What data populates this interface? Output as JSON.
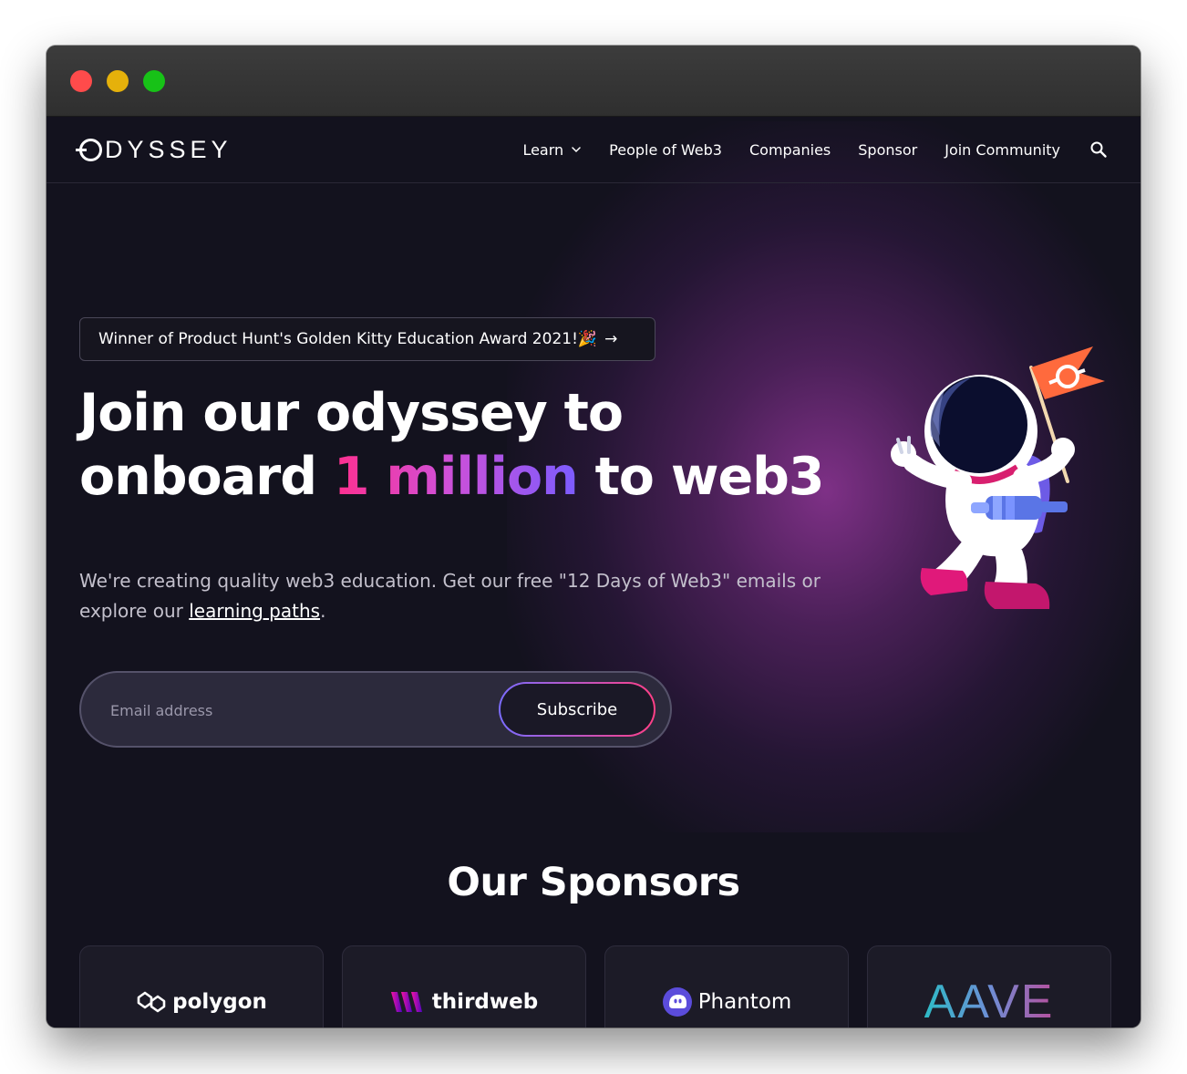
{
  "window": {
    "buttons": [
      "close",
      "minimize",
      "maximize"
    ]
  },
  "brand": {
    "logo_text": "DYSSEY",
    "logo_full": "ODYSSEY"
  },
  "nav": {
    "items": [
      {
        "label": "Learn",
        "has_dropdown": true
      },
      {
        "label": "People of Web3"
      },
      {
        "label": "Companies"
      },
      {
        "label": "Sponsor"
      },
      {
        "label": "Join Community"
      }
    ],
    "search_icon": "search-icon"
  },
  "hero": {
    "badge_text": "Winner of Product Hunt's Golden Kitty Education Award 2021! ",
    "badge_emoji": "🎉",
    "badge_arrow": "→",
    "title_line1": "Join our odyssey to",
    "title_line2_start": "onboard ",
    "title_highlight": "1 million",
    "title_line2_end": " to web3",
    "subtitle_text": "We're creating quality web3 education. Get our free \"12 Days of Web3\" emails or explore our ",
    "subtitle_link": "learning paths",
    "subtitle_end": ".",
    "email_placeholder": "Email address",
    "subscribe_label": "Subscribe"
  },
  "sponsors": {
    "title": "Our Sponsors",
    "items": [
      {
        "name": "polygon",
        "icon": "polygon-logo"
      },
      {
        "name": "thirdweb",
        "icon": "thirdweb-logo"
      },
      {
        "name": "Phantom",
        "icon": "phantom-logo"
      },
      {
        "name": "AAVE",
        "icon": "aave-logo"
      }
    ]
  },
  "colors": {
    "page_bg": "#13121e",
    "highlight_start": "#ff2f8e",
    "highlight_end": "#7b5cff",
    "card_bg": "#1c1b27"
  }
}
